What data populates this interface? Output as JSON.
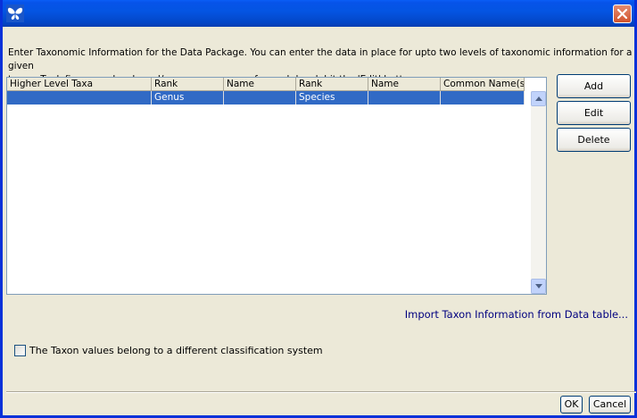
{
  "window": {
    "app_icon": "butterfly-icon",
    "close_icon": "close-icon"
  },
  "instructions": {
    "line1": "Enter Taxonomic Information for the Data Package. You can enter the data in place for upto two levels of taxonomic information for a given",
    "line2": "taxon. To define more levels and/or common names for each level, hit the 'Edit' button"
  },
  "table": {
    "headers": [
      "Higher Level Taxa",
      "Rank",
      "Name",
      "Rank",
      "Name",
      "Common Name(s)"
    ],
    "rows": [
      {
        "higher_level_taxa": "",
        "rank1": "Genus",
        "name1": "",
        "rank2": "Species",
        "name2": "",
        "common_names": ""
      }
    ],
    "selected_row_color": "#316ac5"
  },
  "actions": {
    "add": "Add",
    "edit": "Edit",
    "delete": "Delete"
  },
  "import_link": "Import Taxon Information from Data table...",
  "classification_checkbox": {
    "label": "The Taxon values belong to a different classification system",
    "checked": false
  },
  "footer": {
    "ok": "OK",
    "cancel": "Cancel"
  },
  "colors": {
    "titlebar": "#0a5ef6",
    "dialog_bg": "#ece9d8",
    "link": "#00007f"
  }
}
